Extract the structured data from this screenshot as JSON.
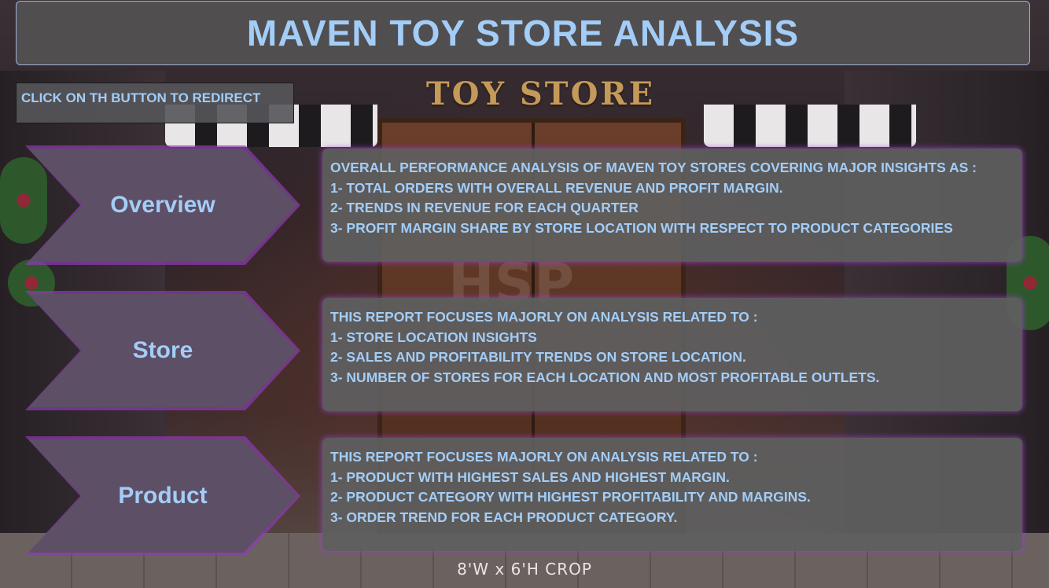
{
  "header": {
    "title": "MAVEN TOY STORE ANALYSIS"
  },
  "hint": {
    "text": "CLICK ON TH BUTTON TO REDIRECT"
  },
  "background": {
    "sign": "TOY STORE",
    "caption": "8'W x 6'H CROP",
    "watermark": "HSP"
  },
  "nav": [
    {
      "label": "Overview"
    },
    {
      "label": "Store"
    },
    {
      "label": "Product"
    }
  ],
  "panels": [
    {
      "lines": [
        "OVERALL PERFORMANCE ANALYSIS OF MAVEN TOY STORES COVERING MAJOR INSIGHTS AS :",
        "1- TOTAL ORDERS WITH OVERALL REVENUE AND PROFIT MARGIN.",
        "2- TRENDS IN REVENUE FOR EACH QUARTER",
        "3- PROFIT MARGIN SHARE BY STORE LOCATION WITH RESPECT TO PRODUCT CATEGORIES"
      ]
    },
    {
      "lines": [
        "THIS REPORT FOCUSES MAJORLY ON ANALYSIS RELATED TO :",
        "1- STORE LOCATION INSIGHTS",
        "2- SALES AND PROFITABILITY TRENDS ON STORE LOCATION.",
        "3- NUMBER OF STORES FOR EACH LOCATION AND MOST PROFITABLE OUTLETS."
      ]
    },
    {
      "lines": [
        "THIS REPORT FOCUSES MAJORLY ON ANALYSIS RELATED TO :",
        "1- PRODUCT WITH HIGHEST SALES AND HIGHEST MARGIN.",
        "2- PRODUCT CATEGORY WITH HIGHEST PROFITABILITY AND MARGINS.",
        "3- ORDER TREND FOR EACH PRODUCT CATEGORY."
      ]
    }
  ],
  "colors": {
    "accent_text": "#a3cdf7",
    "button_fill": "#5d4f66",
    "glow": "#9b3fc4"
  }
}
